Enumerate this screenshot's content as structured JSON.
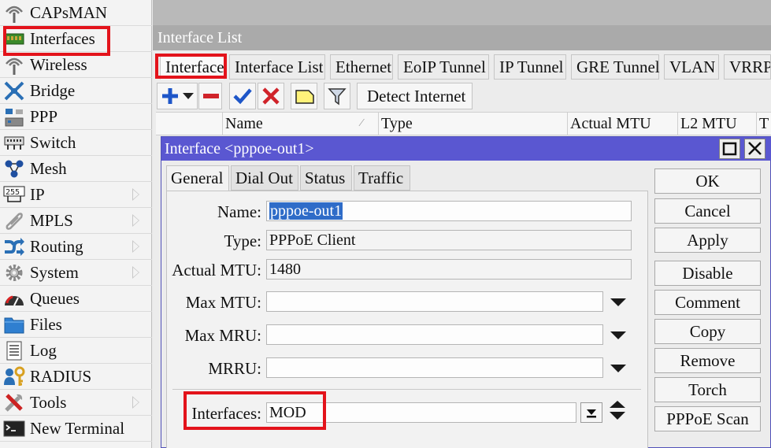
{
  "sidebar": {
    "items": [
      {
        "label": "CAPsMAN",
        "icon": "capsman-icon",
        "submenu": false
      },
      {
        "label": "Interfaces",
        "icon": "interfaces-icon",
        "submenu": false
      },
      {
        "label": "Wireless",
        "icon": "wireless-icon",
        "submenu": false
      },
      {
        "label": "Bridge",
        "icon": "bridge-icon",
        "submenu": false
      },
      {
        "label": "PPP",
        "icon": "ppp-icon",
        "submenu": false
      },
      {
        "label": "Switch",
        "icon": "switch-icon",
        "submenu": false
      },
      {
        "label": "Mesh",
        "icon": "mesh-icon",
        "submenu": false
      },
      {
        "label": "IP",
        "icon": "ip-icon",
        "submenu": true
      },
      {
        "label": "MPLS",
        "icon": "mpls-icon",
        "submenu": true
      },
      {
        "label": "Routing",
        "icon": "routing-icon",
        "submenu": true
      },
      {
        "label": "System",
        "icon": "system-gear-icon",
        "submenu": true
      },
      {
        "label": "Queues",
        "icon": "queues-icon",
        "submenu": false
      },
      {
        "label": "Files",
        "icon": "folder-icon",
        "submenu": false
      },
      {
        "label": "Log",
        "icon": "log-icon",
        "submenu": false
      },
      {
        "label": "RADIUS",
        "icon": "radius-icon",
        "submenu": false
      },
      {
        "label": "Tools",
        "icon": "tools-icon",
        "submenu": true
      },
      {
        "label": "New Terminal",
        "icon": "terminal-icon",
        "submenu": false
      }
    ]
  },
  "interface_list": {
    "title": "Interface List",
    "tabs": [
      "Interface",
      "Interface List",
      "Ethernet",
      "EoIP Tunnel",
      "IP Tunnel",
      "GRE Tunnel",
      "VLAN",
      "VRRP"
    ],
    "active_tab": "Interface",
    "toolbar": {
      "detect_label": "Detect Internet",
      "icons": [
        "add-icon",
        "dropdown-arrow-icon",
        "remove-icon",
        "enable-check-icon",
        "disable-x-icon",
        "comment-icon",
        "filter-icon"
      ]
    },
    "columns": [
      "Name",
      "Type",
      "Actual MTU",
      "L2 MTU",
      "T"
    ]
  },
  "dialog": {
    "title": "Interface <pppoe-out1>",
    "tabs": [
      "General",
      "Dial Out",
      "Status",
      "Traffic"
    ],
    "active_tab": "General",
    "fields": {
      "name": {
        "label": "Name:",
        "value": "pppoe-out1"
      },
      "type": {
        "label": "Type:",
        "value": "PPPoE Client"
      },
      "actual_mtu": {
        "label": "Actual MTU:",
        "value": "1480"
      },
      "max_mtu": {
        "label": "Max MTU:",
        "value": ""
      },
      "max_mru": {
        "label": "Max MRU:",
        "value": ""
      },
      "mrru": {
        "label": "MRRU:",
        "value": ""
      },
      "interfaces": {
        "label": "Interfaces:",
        "value": "MOD"
      }
    },
    "buttons": [
      "OK",
      "Cancel",
      "Apply",
      "Disable",
      "Comment",
      "Copy",
      "Remove",
      "Torch",
      "PPPoE Scan"
    ]
  },
  "colors": {
    "dialog_title": "#5a57d1",
    "highlight": "#e3131b",
    "selection": "#2f6cc8"
  }
}
